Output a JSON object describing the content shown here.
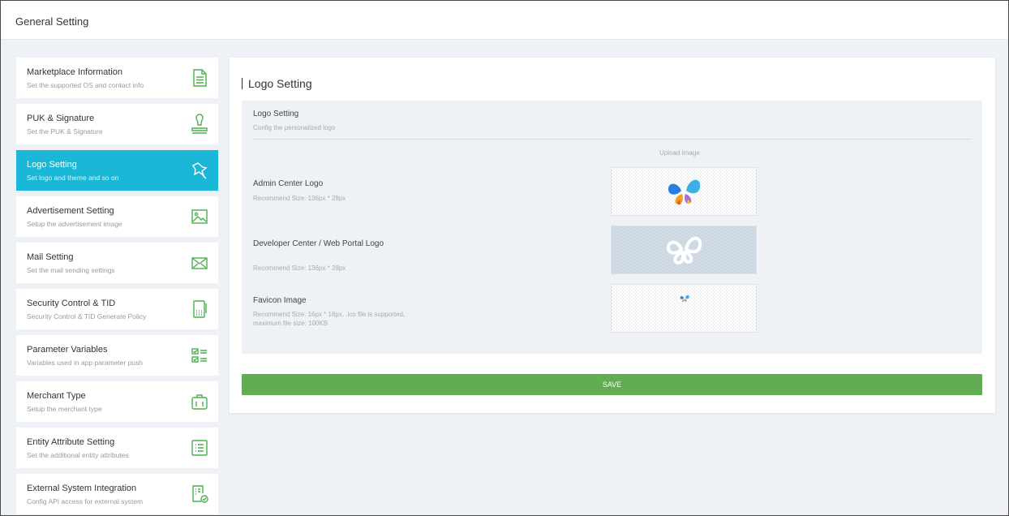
{
  "header": {
    "title": "General Setting"
  },
  "sidebar": {
    "items": [
      {
        "title": "Marketplace Information",
        "desc": "Set the supported OS and contact info",
        "icon": "document-icon",
        "active": false
      },
      {
        "title": "PUK & Signature",
        "desc": "Set the PUK & Signature",
        "icon": "stamp-icon",
        "active": false
      },
      {
        "title": "Logo Setting",
        "desc": "Set logo and theme and so on",
        "icon": "brush-icon",
        "active": true
      },
      {
        "title": "Advertisement Setting",
        "desc": "Setup the advertisement image",
        "icon": "image-icon",
        "active": false
      },
      {
        "title": "Mail Setting",
        "desc": "Set the mail sending settings",
        "icon": "mail-icon",
        "active": false
      },
      {
        "title": "Security Control & TID",
        "desc": "Security Control & TID Generate Policy",
        "icon": "terminal-icon",
        "active": false
      },
      {
        "title": "Parameter Variables",
        "desc": "Variables used in app parameter push",
        "icon": "checklist-icon",
        "active": false
      },
      {
        "title": "Merchant Type",
        "desc": "Setup the merchant type",
        "icon": "briefcase-icon",
        "active": false
      },
      {
        "title": "Entity Attribute Setting",
        "desc": "Set the additional entity attributes",
        "icon": "list-icon",
        "active": false
      },
      {
        "title": "External System Integration",
        "desc": "Config API access for external system",
        "icon": "integration-icon",
        "active": false
      }
    ]
  },
  "main": {
    "title": "Logo Setting",
    "section": {
      "title": "Logo Setting",
      "desc": "Config the personalized logo",
      "upload_label": "Upload Image",
      "rows": [
        {
          "title": "Admin Center Logo",
          "recommend": "Recommend Size: 136px * 28px"
        },
        {
          "title": "Developer Center / Web Portal Logo",
          "recommend": "Recommend Size: 136px * 28px"
        },
        {
          "title": "Favicon Image",
          "recommend": "Recommend Size: 16px * 16px, .ico file is supported, maximum file size: 100KB"
        }
      ]
    },
    "save_label": "SAVE"
  },
  "colors": {
    "accent": "#1ab8d6",
    "icon": "#4caf50",
    "save": "#62ad53",
    "background": "#eef1f5"
  }
}
